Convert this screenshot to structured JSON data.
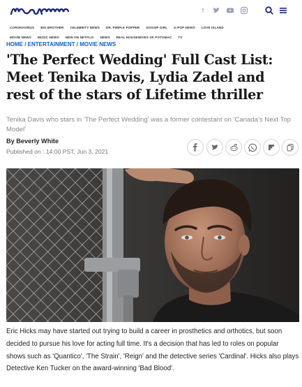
{
  "header": {
    "logo_text": "meaww",
    "social_icons": [
      "facebook-icon",
      "twitter-icon",
      "youtube-icon",
      "instagram-icon"
    ],
    "search_icon": "search-icon",
    "menu_icon": "menu-icon"
  },
  "nav": {
    "row1": [
      "CORONAVIRUS",
      "BIG BROTHER",
      "CELEBRITY NEWS",
      "DR. PIMPLE POPPER",
      "GOSSIP GIRL",
      "K-POP NEWS",
      "LOVE ISLAND"
    ],
    "row2": [
      "MOVIE NEWS",
      "MUSIC NEWS",
      "NEW ON NETFLIX",
      "NEWS",
      "REAL HOUSEWIVES OF POTOMAC",
      "TV"
    ]
  },
  "breadcrumb": {
    "home": "HOME",
    "entertainment": "ENTERTAINMENT",
    "movie_news": "MOVIE NEWS",
    "sep": " / "
  },
  "article": {
    "headline": "'The Perfect Wedding' Full Cast List: Meet Tenika Davis, Lydia Zadel and rest of the stars of Lifetime thriller",
    "subtitle": "Tenika Davis who stars in 'The Perfect Wedding' was a former contestant on 'Canada's Next Top Model'",
    "author": "By Beverly White",
    "published": "Published on : 14:00 PST, Jun 3, 2021",
    "body": "Eric Hicks may have started out trying to build a career in prosthetics and orthotics, but soon decided to pursue his love for acting full time. It's a decision that has led to roles on popular shows such as 'Quantico', 'The Strain', 'Reign' and the detective series 'Cardinal'. Hicks also plays Detective Ken Tucker on the award-winning 'Bad Blood'."
  },
  "share_icons": [
    "facebook-share-icon",
    "twitter-share-icon",
    "reddit-share-icon",
    "whatsapp-share-icon",
    "flipboard-share-icon",
    "copy-link-icon"
  ],
  "colors": {
    "brand_blue": "#1e2a6e",
    "link_blue": "#0c63c5"
  }
}
